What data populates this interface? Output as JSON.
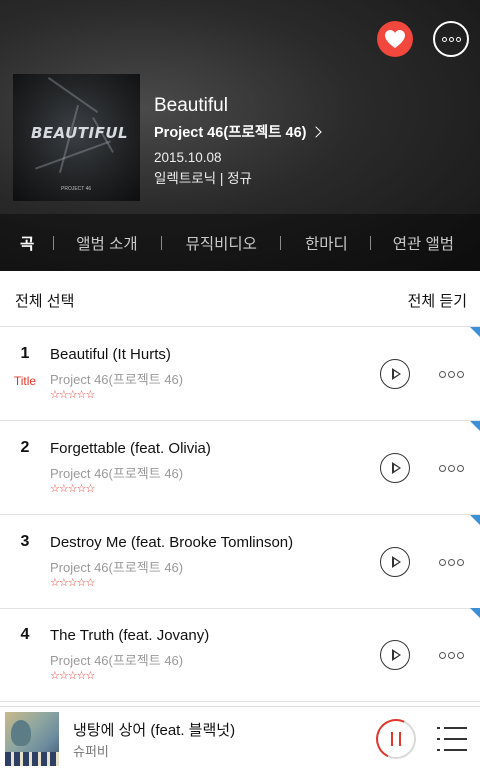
{
  "header": {
    "album_title": "Beautiful",
    "artist": "Project 46(프로젝트 46)",
    "release_date": "2015.10.08",
    "genre_type": "일렉트로닉 | 정규",
    "cover_art_text": "BEAUTIFUL",
    "cover_art_sub": "PROJECT 46"
  },
  "tabs": [
    {
      "label": "곡",
      "active": true
    },
    {
      "label": "앨범 소개",
      "active": false
    },
    {
      "label": "뮤직비디오",
      "active": false
    },
    {
      "label": "한마디",
      "active": false
    },
    {
      "label": "연관 앨범",
      "active": false
    }
  ],
  "toolbar": {
    "select_all": "전체 선택",
    "play_all": "전체 듣기"
  },
  "songs": [
    {
      "number": "1",
      "badge": "Title",
      "title": "Beautiful (It Hurts)",
      "artist": "Project 46(프로젝트 46)",
      "rating": "☆☆☆☆☆"
    },
    {
      "number": "2",
      "badge": "",
      "title": "Forgettable (feat. Olivia)",
      "artist": "Project 46(프로젝트 46)",
      "rating": "☆☆☆☆☆"
    },
    {
      "number": "3",
      "badge": "",
      "title": "Destroy Me (feat. Brooke Tomlinson)",
      "artist": "Project 46(프로젝트 46)",
      "rating": "☆☆☆☆☆"
    },
    {
      "number": "4",
      "badge": "",
      "title": "The Truth (feat. Jovany)",
      "artist": "Project 46(프로젝트 46)",
      "rating": "☆☆☆☆☆"
    }
  ],
  "player": {
    "title": "냉탕에 상어 (feat. 블랙넛)",
    "artist": "슈퍼비"
  },
  "colors": {
    "accent": "#e3372d",
    "like": "#f1473c",
    "corner_marker": "#3d8fd6"
  },
  "icons": {
    "like": "heart-icon",
    "more": "more-dots-icon",
    "play": "play-icon",
    "pause": "pause-icon",
    "playlist": "playlist-icon",
    "artist_link": "chevron-right-icon"
  }
}
